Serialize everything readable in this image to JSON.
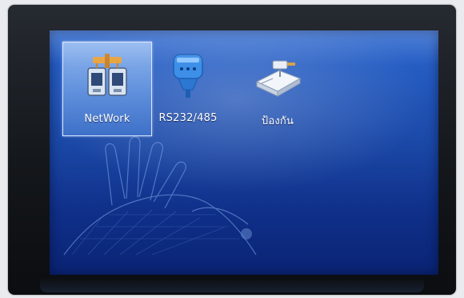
{
  "menu": {
    "items": [
      {
        "label": "NetWork",
        "icon": "network-icon",
        "selected": true
      },
      {
        "label": "RS232/485",
        "icon": "serial-port-icon",
        "selected": false
      },
      {
        "label": "ป้องกัน",
        "icon": "protection-device-icon",
        "selected": false
      }
    ]
  },
  "colors": {
    "screen_top": "#2a66cf",
    "screen_bottom": "#0a2474",
    "selection": "#5f8fdc",
    "bezel": "#1a1d22"
  }
}
